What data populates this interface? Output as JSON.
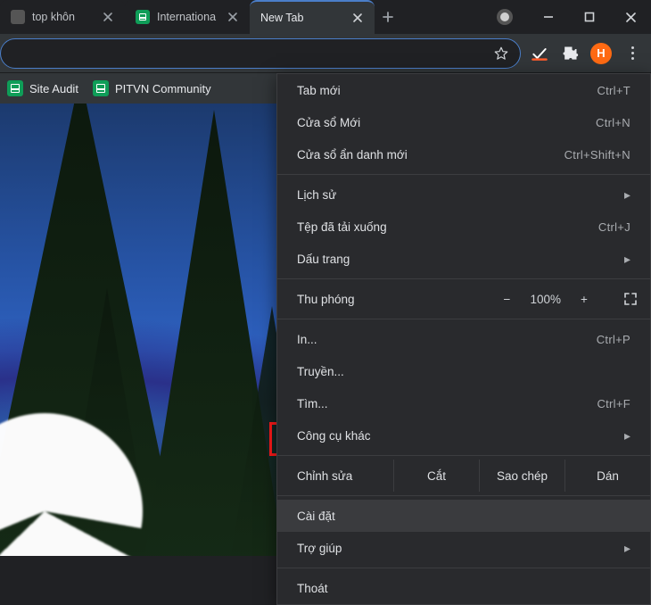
{
  "tabs": [
    {
      "title": "top khôn",
      "active": false,
      "favicon": "generic"
    },
    {
      "title": "Internationa",
      "active": false,
      "favicon": "sheets"
    },
    {
      "title": "New Tab",
      "active": true,
      "favicon": "none"
    }
  ],
  "toolbar": {
    "avatar_letter": "H"
  },
  "bookmarks": [
    {
      "label": "Site Audit"
    },
    {
      "label": "PITVN Community"
    }
  ],
  "menu": {
    "new_tab": {
      "label": "Tab mới",
      "shortcut": "Ctrl+T"
    },
    "new_window": {
      "label": "Cửa sổ Mới",
      "shortcut": "Ctrl+N"
    },
    "incognito": {
      "label": "Cửa sổ ẩn danh mới",
      "shortcut": "Ctrl+Shift+N"
    },
    "history": {
      "label": "Lịch sử"
    },
    "downloads": {
      "label": "Tệp đã tải xuống",
      "shortcut": "Ctrl+J"
    },
    "bookmarks": {
      "label": "Dấu trang"
    },
    "zoom": {
      "label": "Thu phóng",
      "minus": "−",
      "value": "100%",
      "plus": "+"
    },
    "print": {
      "label": "In...",
      "shortcut": "Ctrl+P"
    },
    "cast": {
      "label": "Truyền..."
    },
    "find": {
      "label": "Tìm...",
      "shortcut": "Ctrl+F"
    },
    "more_tools": {
      "label": "Công cụ khác"
    },
    "edit": {
      "label": "Chỉnh sửa",
      "cut": "Cắt",
      "copy": "Sao chép",
      "paste": "Dán"
    },
    "settings": {
      "label": "Cài đặt"
    },
    "help": {
      "label": "Trợ giúp"
    },
    "exit": {
      "label": "Thoát"
    }
  }
}
